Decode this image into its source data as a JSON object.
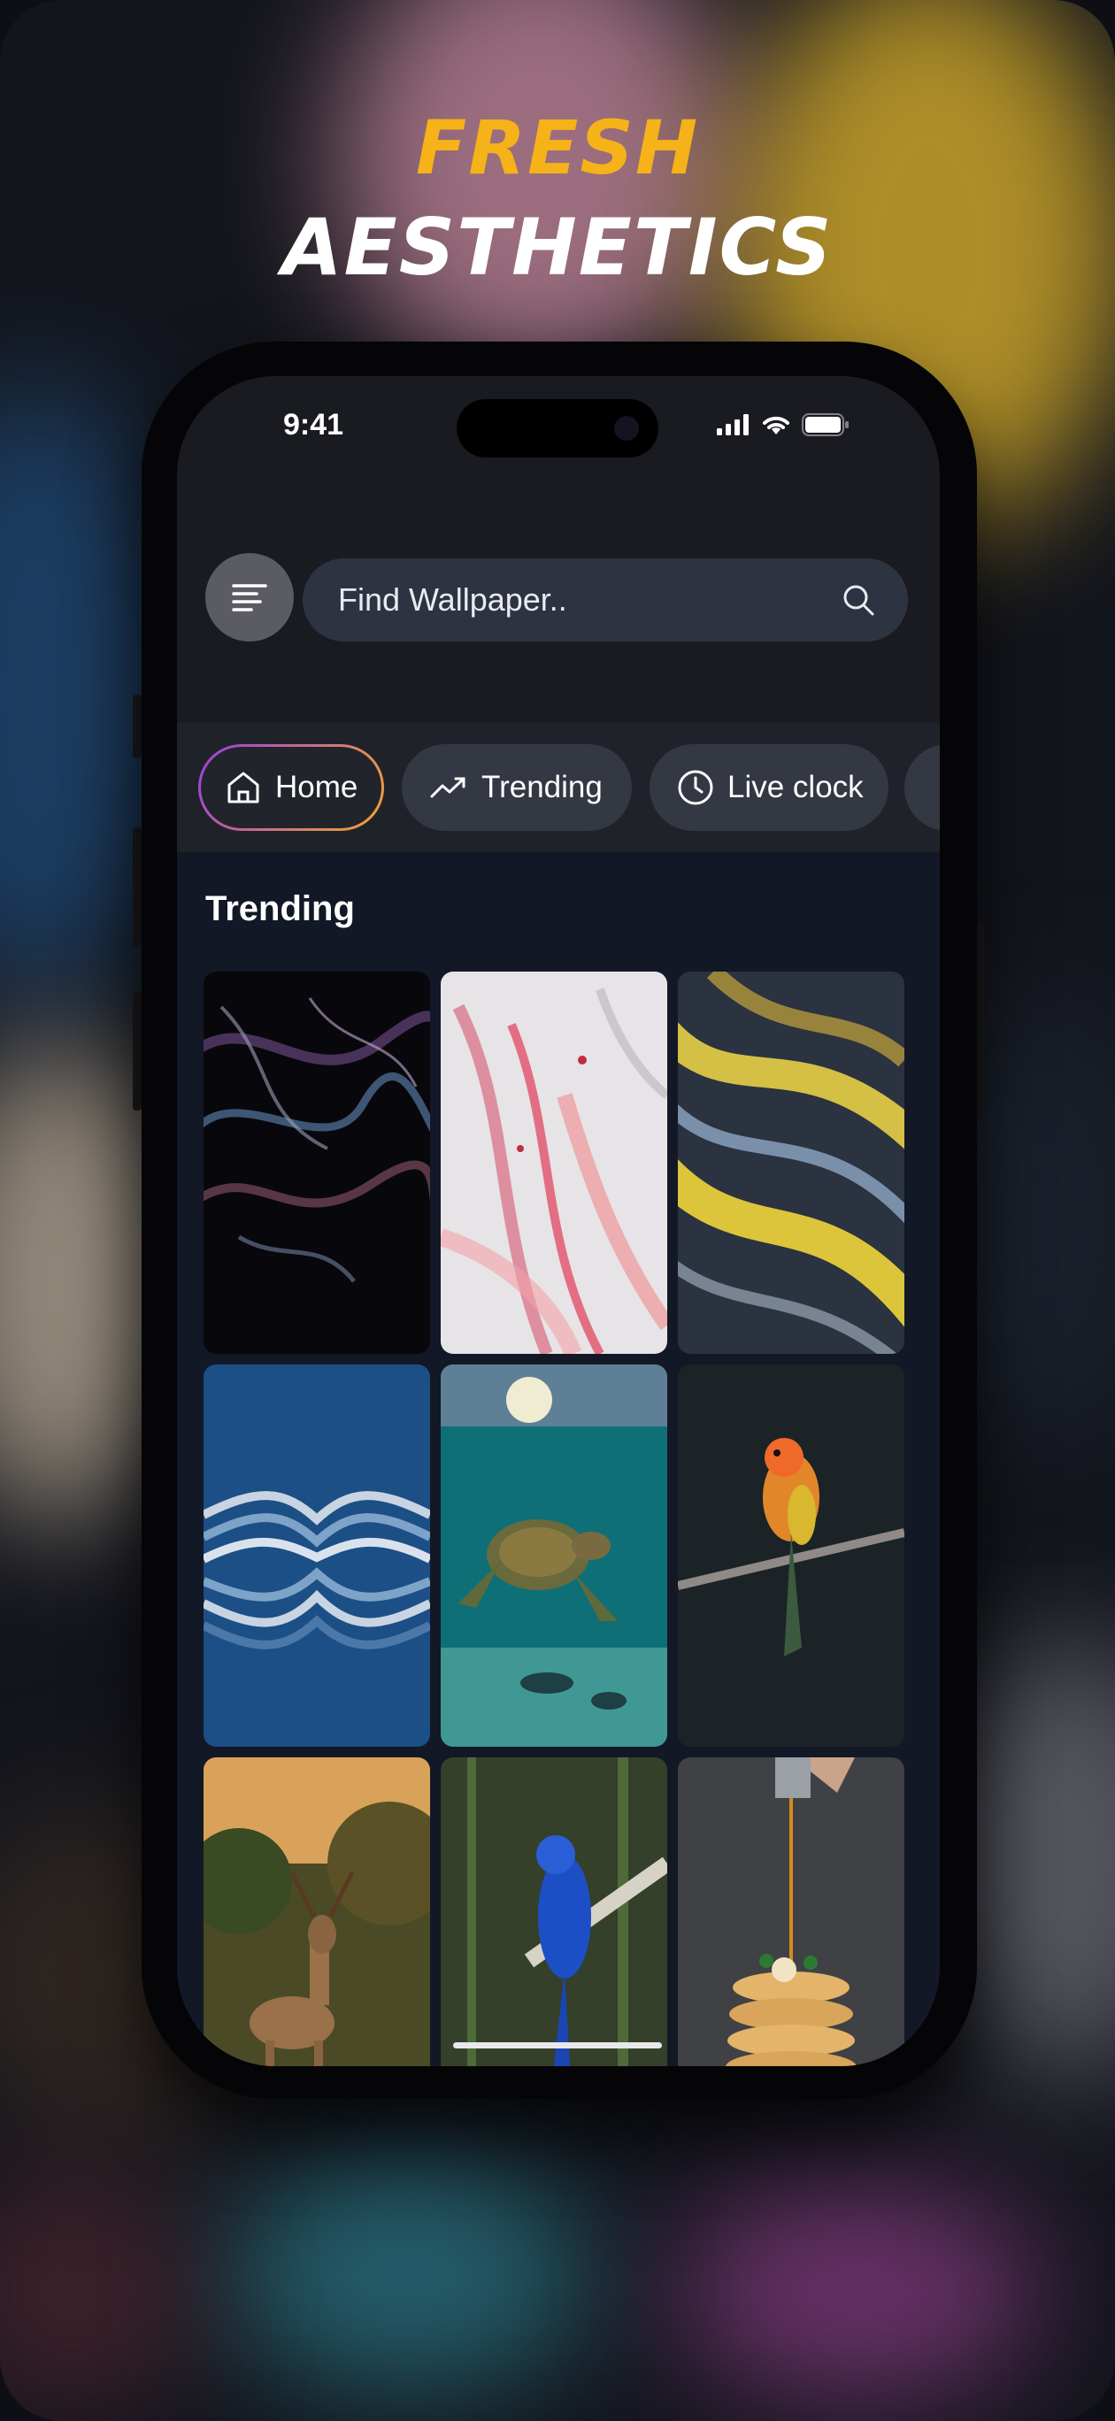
{
  "headline": {
    "line1": "FRESH",
    "line2": "AESTHETICS"
  },
  "status_bar": {
    "time": "9:41"
  },
  "search": {
    "placeholder": "Find Wallpaper.."
  },
  "categories": [
    {
      "label": "Home",
      "icon": "home-icon",
      "active": true
    },
    {
      "label": "Trending",
      "icon": "trending-icon",
      "active": false
    },
    {
      "label": "Live clock",
      "icon": "clock-icon",
      "active": false
    }
  ],
  "section": {
    "title": "Trending"
  },
  "wallpapers": [
    {
      "subject": "abstract-fluid-dark"
    },
    {
      "subject": "pink-white-marble"
    },
    {
      "subject": "yellow-blue-waves"
    },
    {
      "subject": "blue-mirror-abstract"
    },
    {
      "subject": "sea-turtle"
    },
    {
      "subject": "orange-parrot"
    },
    {
      "subject": "deer"
    },
    {
      "subject": "blue-macaw"
    },
    {
      "subject": "pancakes"
    }
  ],
  "colors": {
    "accent_yellow": "#f5b219",
    "chip_gradient_start": "#9b3fe0",
    "chip_gradient_end": "#f4a52e",
    "screen_bg": "#121826"
  }
}
